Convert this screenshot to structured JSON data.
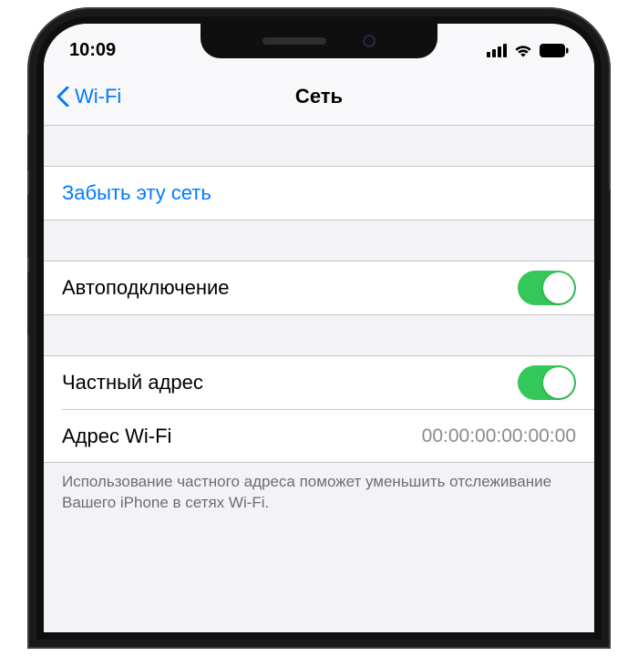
{
  "status": {
    "time": "10:09"
  },
  "nav": {
    "back_label": "Wi-Fi",
    "title": "Сеть"
  },
  "forget": {
    "label": "Забыть эту сеть"
  },
  "auto_join": {
    "label": "Автоподключение",
    "on": true
  },
  "private_addr": {
    "label": "Частный адрес",
    "on": true
  },
  "wifi_addr": {
    "label": "Адрес Wi-Fi",
    "value": "00:00:00:00:00:00"
  },
  "footer": {
    "text": "Использование частного адреса поможет уменьшить отслеживание Вашего iPhone в сетях Wi-Fi."
  }
}
